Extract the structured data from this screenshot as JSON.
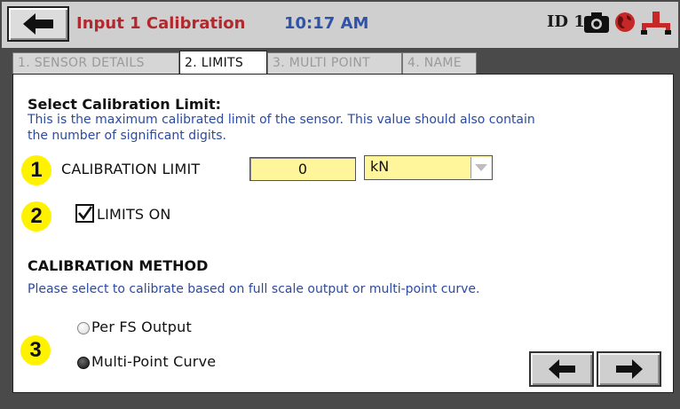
{
  "header": {
    "title": "Input 1 Calibration",
    "time": "10:17 AM",
    "device_id": "ID 1",
    "icons": [
      "back-arrow-icon",
      "camera-icon",
      "globe-icon",
      "network-icon"
    ]
  },
  "tabs": [
    {
      "label": "1. SENSOR DETAILS",
      "active": false
    },
    {
      "label": "2. LIMITS",
      "active": true
    },
    {
      "label": "3. MULTI POINT",
      "active": false
    },
    {
      "label": "4. NAME",
      "active": false
    }
  ],
  "limits": {
    "heading": "Select Calibration Limit:",
    "description_line1": "This is the maximum calibrated limit of the sensor.  This value should also contain",
    "description_line2": "the number of significant digits.",
    "step1": "1",
    "calibration_label": "CALIBRATION LIMIT",
    "calibration_value": "0",
    "unit": "kN",
    "step2": "2",
    "limits_on_label": "LIMITS ON",
    "limits_on_checked": true
  },
  "method": {
    "heading": "CALIBRATION METHOD",
    "description": "Please select to calibrate based on full scale output or multi-point curve.",
    "step3": "3",
    "options": [
      {
        "label": "Per FS Output",
        "selected": false
      },
      {
        "label": "Multi-Point Curve",
        "selected": true
      }
    ]
  },
  "nav": {
    "icons": [
      "back-arrow-icon",
      "forward-arrow-icon"
    ]
  },
  "colors": {
    "title": "#b1292f",
    "clock": "#2f53a8",
    "description": "#2b4aa0",
    "field_fill": "#fff59a",
    "step_badge": "#fff200"
  }
}
